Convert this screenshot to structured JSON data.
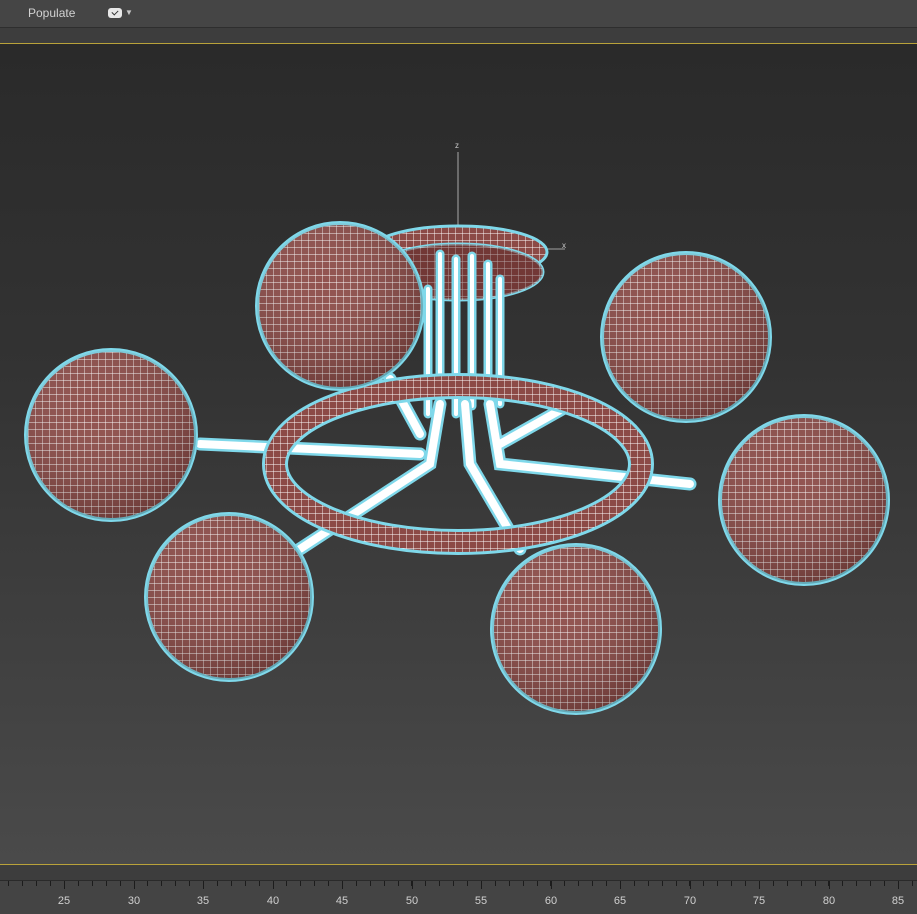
{
  "ribbon": {
    "tab_label": "Populate",
    "toggle_icon": "ribbon-toggle-icon"
  },
  "viewport": {
    "axis_z_label": "z",
    "axis_x_label": "x",
    "border_color": "#b9a23a",
    "mesh_color": "#8c4a46",
    "wire_color": "#ffffff",
    "selection_glow_color": "#7fd8ea"
  },
  "timeline": {
    "labels": [
      "25",
      "30",
      "35",
      "40",
      "45",
      "50",
      "55",
      "60",
      "65",
      "70",
      "75",
      "80",
      "85"
    ]
  }
}
